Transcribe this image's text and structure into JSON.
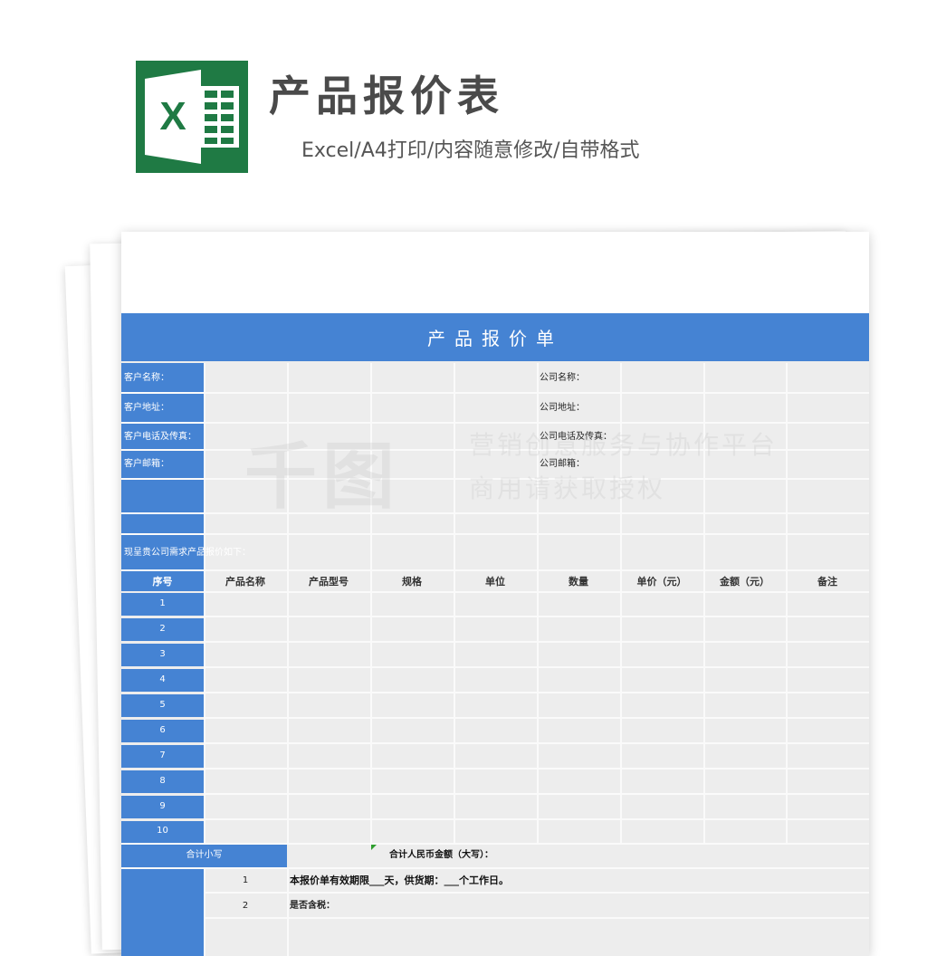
{
  "header": {
    "title": "产品报价表",
    "subtitle": "Excel/A4打印/内容随意修改/自带格式",
    "logo_icon": "excel-icon",
    "logo_letter": "X"
  },
  "sheet": {
    "title": "产品报价单",
    "client_labels": [
      "客户名称：",
      "客户地址：",
      "客户电话及传真：",
      "客户邮箱："
    ],
    "company_labels": [
      "公司名称：",
      "公司地址：",
      "公司电话及传真：",
      "公司邮箱："
    ],
    "intro": "现呈贵公司需求产品报价如下：",
    "columns": [
      "序号",
      "产品名称",
      "产品型号",
      "规格",
      "单位",
      "数量",
      "单价（元）",
      "金额（元）",
      "备注"
    ],
    "rows": [
      "1",
      "2",
      "3",
      "4",
      "5",
      "6",
      "7",
      "8",
      "9",
      "10"
    ],
    "subtotal_label": "合计小写",
    "total_upper_label": "合计人民币金额（大写）：",
    "notes": [
      {
        "num": "1",
        "text": "本报价单有效期限___天，供货期：___个工作日。"
      },
      {
        "num": "2",
        "text": "是否含税："
      }
    ]
  },
  "watermark": {
    "brand": "千图",
    "line1": "营销创意服务与协作平台",
    "line2": "商用请获取授权"
  },
  "colors": {
    "accent": "#4583d3",
    "excel_green": "#1f7a44",
    "grid_bg": "#ededed"
  }
}
